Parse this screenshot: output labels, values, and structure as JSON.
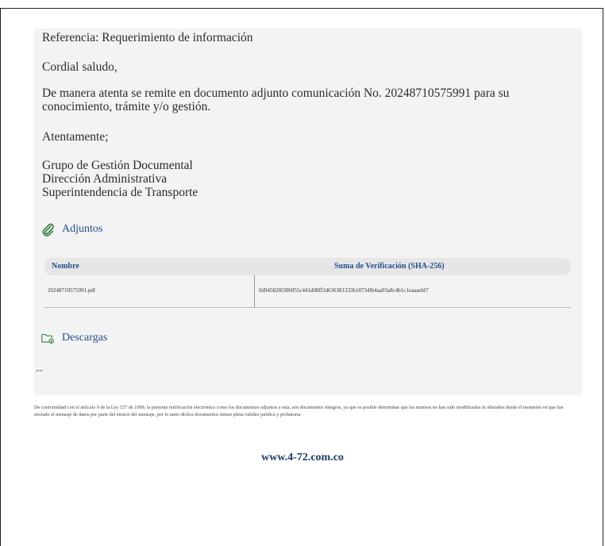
{
  "email": {
    "reference": "Referencia: Requerimiento de información",
    "greeting": "Cordial saludo,",
    "body": "De manera atenta se remite en documento adjunto comunicación No. 20248710575991 para su conocimiento, trámite y/o gestión.",
    "closing": "Atentamente;",
    "signature": [
      "Grupo de Gestión Documental",
      "Dirección Administrativa",
      "Superintendencia de Transporte"
    ]
  },
  "attachments": {
    "title": "Adjuntos",
    "icon": "paperclip-icon",
    "columns": {
      "name": "Nombre",
      "hash": "Suma de Verificación (SHA-256)"
    },
    "rows": [
      {
        "name": "20248710575991.pdf",
        "hash": "0d945828f30b955c441d08ff2d636381333b18734fb4aa03a8c4b1c1eaaaebf7"
      }
    ]
  },
  "downloads": {
    "title": "Descargas",
    "icon": "folder-download-icon",
    "content": "--"
  },
  "footer": {
    "legal": "De conformidad con el artículo 9 de la Ley 527 de 1999, la presente notificación electrónica como los documentos adjuntos a esta, son documentos íntegros, ya que es posible determinar que los mismos no han sido modificados ni alterados desde el momento en que fue enviado el mensaje de datos por parte del emisor del mensaje, por lo tanto dichos documentos tienen plena validez jurídica y probatoria.",
    "site": "www.4-72.com.co"
  },
  "colors": {
    "accent": "#1f4e8c",
    "panel": "#f3f3f3",
    "header_row": "#e6e6e6"
  }
}
